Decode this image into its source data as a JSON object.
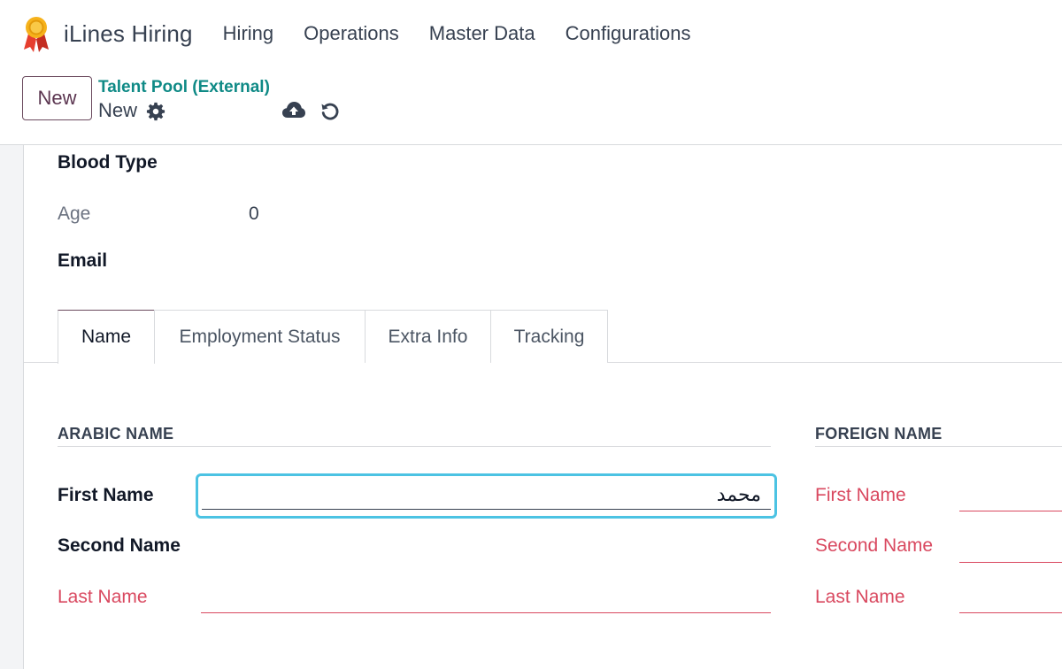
{
  "app": {
    "title": "iLines Hiring"
  },
  "nav": {
    "items": [
      "Hiring",
      "Operations",
      "Master Data",
      "Configurations"
    ]
  },
  "control": {
    "new_label": "New",
    "breadcrumb": "Talent Pool (External)",
    "record_name": "New"
  },
  "form": {
    "blood_type_label": "Blood Type",
    "age_label": "Age",
    "age_value": "0",
    "email_label": "Email"
  },
  "tabs": [
    "Name",
    "Employment Status",
    "Extra Info",
    "Tracking"
  ],
  "arabic_name": {
    "title": "ARABIC NAME",
    "first_name_label": "First Name",
    "first_name_value": "محمد",
    "second_name_label": "Second Name",
    "last_name_label": "Last Name"
  },
  "foreign_name": {
    "title": "FOREIGN NAME",
    "first_name_label": "First Name",
    "second_name_label": "Second Name",
    "last_name_label": "Last Name"
  },
  "colors": {
    "accent": "#6b4a5e",
    "link": "#0f8a86",
    "required": "#d9485f",
    "focus": "#4cc3e3"
  },
  "icons": [
    "medal-icon",
    "gear-icon",
    "cloud-upload-icon",
    "undo-icon"
  ]
}
